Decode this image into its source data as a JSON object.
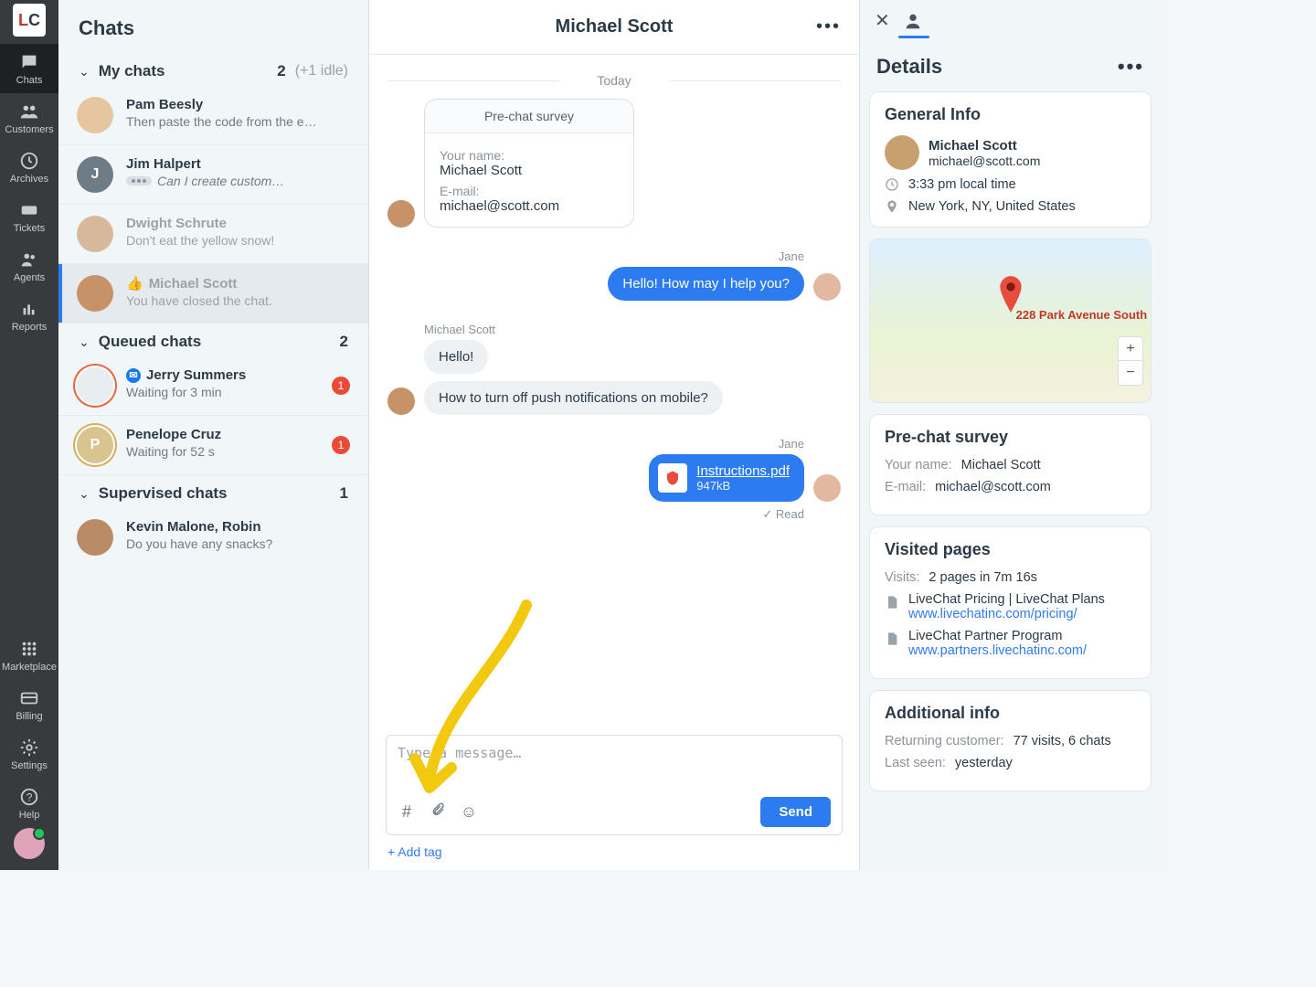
{
  "rail": {
    "items": [
      {
        "label": "Chats"
      },
      {
        "label": "Customers"
      },
      {
        "label": "Archives"
      },
      {
        "label": "Tickets"
      },
      {
        "label": "Agents"
      },
      {
        "label": "Reports"
      }
    ],
    "bottom": [
      {
        "label": "Marketplace"
      },
      {
        "label": "Billing"
      },
      {
        "label": "Settings"
      },
      {
        "label": "Help"
      }
    ]
  },
  "chatlist": {
    "title": "Chats",
    "sections": {
      "my": {
        "title": "My chats",
        "count": "2",
        "idle": "(+1 idle)"
      },
      "queued": {
        "title": "Queued chats",
        "count": "2"
      },
      "supervised": {
        "title": "Supervised chats",
        "count": "1"
      }
    },
    "my_items": [
      {
        "name": "Pam Beesly",
        "sub": "Then paste the code from the e…"
      },
      {
        "name": "Jim Halpert",
        "sub": "Can I create custom…"
      },
      {
        "name": "Dwight Schrute",
        "sub": "Don't eat the yellow snow!"
      },
      {
        "name": "Michael Scott",
        "sub": "You have closed the chat."
      }
    ],
    "queued_items": [
      {
        "name": "Jerry Summers",
        "sub": "Waiting for 3 min",
        "badge": "1"
      },
      {
        "name": "Penelope Cruz",
        "sub": "Waiting for 52 s",
        "badge": "1"
      }
    ],
    "supervised_items": [
      {
        "name": "Kevin Malone, Robin",
        "sub": "Do you have any snacks?"
      }
    ]
  },
  "convo": {
    "title": "Michael Scott",
    "date": "Today",
    "survey": {
      "title": "Pre-chat survey",
      "name_label": "Your name:",
      "name_value": "Michael Scott",
      "email_label": "E-mail:",
      "email_value": "michael@scott.com"
    },
    "jane": "Jane",
    "jane_msg1": "Hello! How may I help you?",
    "michael_label": "Michael Scott",
    "michael_msg1": "Hello!",
    "michael_msg2": "How to turn off push notifications on mobile?",
    "file": {
      "name": "Instructions.pdf",
      "size": "947kB"
    },
    "read": "Read",
    "placeholder": "Type a message…",
    "send": "Send",
    "add_tag": "+ Add tag"
  },
  "details": {
    "title": "Details",
    "general": {
      "title": "General Info",
      "name": "Michael Scott",
      "email": "michael@scott.com",
      "time": "3:33 pm local time",
      "loc": "New York, NY, United States",
      "address": "228 Park Avenue South"
    },
    "prechat": {
      "title": "Pre-chat survey",
      "name_label": "Your name:",
      "name_value": "Michael Scott",
      "email_label": "E-mail:",
      "email_value": "michael@scott.com"
    },
    "visited": {
      "title": "Visited pages",
      "visits_label": "Visits:",
      "visits_value": "2 pages in 7m 16s",
      "pages": [
        {
          "title": "LiveChat Pricing | LiveChat Plans",
          "url": "www.livechatinc.com/pricing/"
        },
        {
          "title": "LiveChat Partner Program",
          "url": "www.partners.livechatinc.com/"
        }
      ]
    },
    "additional": {
      "title": "Additional info",
      "ret_label": "Returning customer:",
      "ret_value": "77 visits, 6 chats",
      "seen_label": "Last seen:",
      "seen_value": "yesterday"
    }
  }
}
